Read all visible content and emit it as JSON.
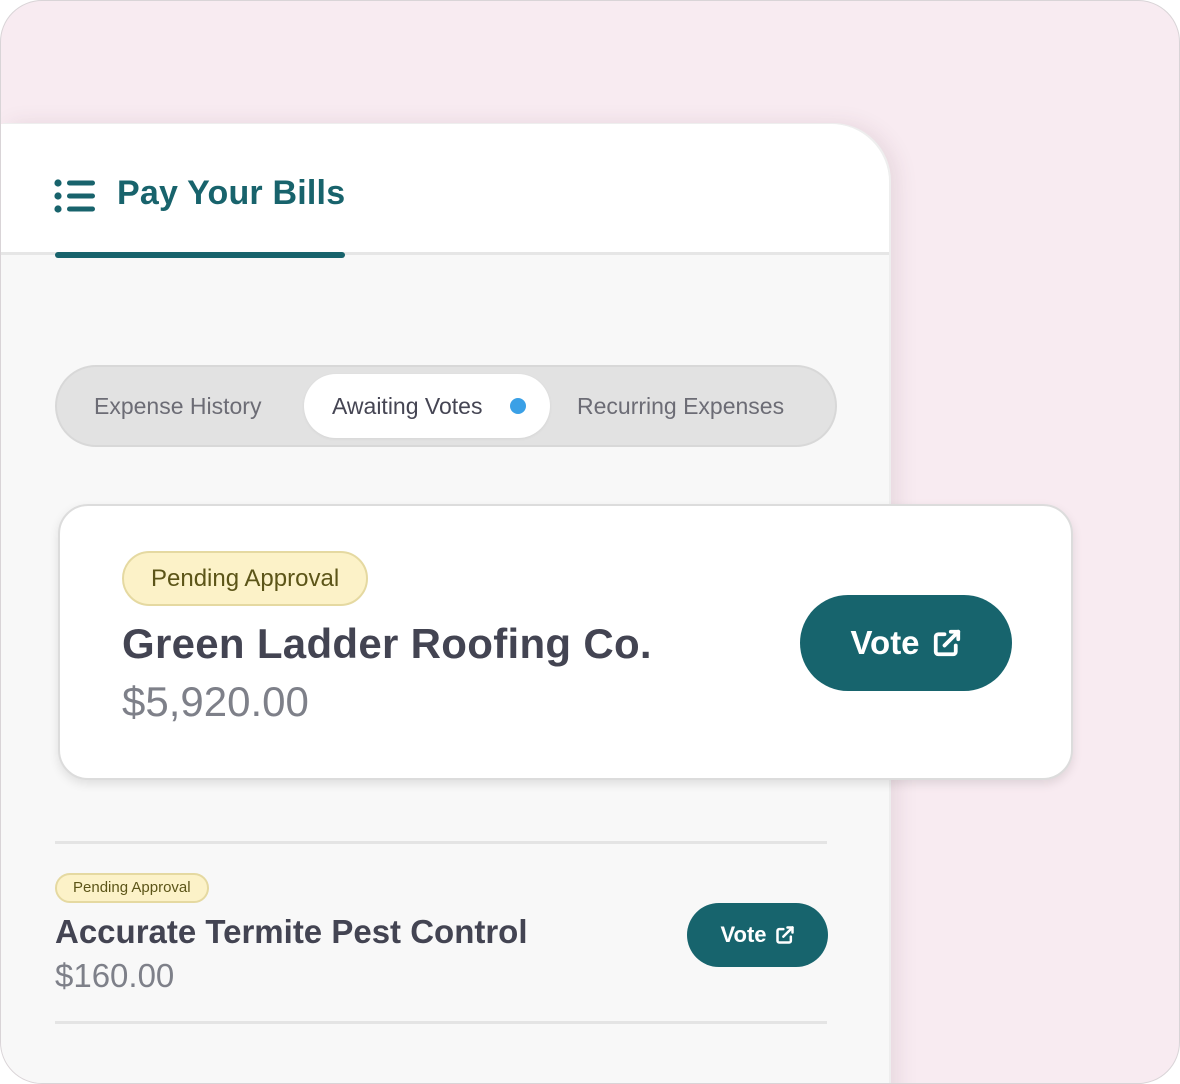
{
  "header": {
    "title": "Pay Your Bills",
    "icon": "list-icon"
  },
  "tabs": {
    "items": [
      {
        "label": "Expense History"
      },
      {
        "label": "Awaiting Votes",
        "active": true,
        "has_notification_dot": true
      },
      {
        "label": "Recurring Expenses"
      }
    ]
  },
  "expenses": [
    {
      "status": "Pending Approval",
      "vendor": "Green Ladder Roofing Co.",
      "amount": "$5,920.00",
      "action_label": "Vote",
      "action_icon": "external-link-icon"
    },
    {
      "status": "Pending Approval",
      "vendor": "Accurate Termite Pest Control",
      "amount": "$160.00",
      "action_label": "Vote",
      "action_icon": "external-link-icon"
    }
  ],
  "colors": {
    "brand": "#18636c",
    "background": "#f8ebf1",
    "badge_bg": "#fcf2c8",
    "notification_dot": "#3aa0e6"
  }
}
